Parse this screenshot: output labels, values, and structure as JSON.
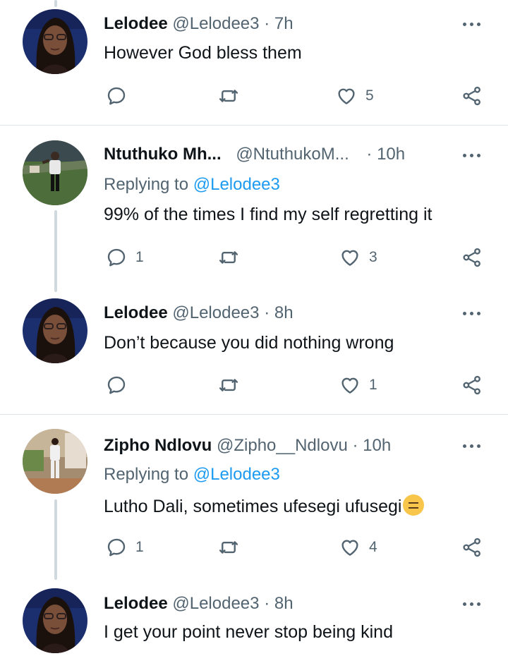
{
  "tweets": [
    {
      "name": "Lelodee",
      "handle": "@Lelodee3",
      "sep": "·",
      "time": "7h",
      "replying_label": "",
      "replying_to": "",
      "text": "However God bless them",
      "replies": "",
      "retweets": "",
      "likes": "5",
      "avatar": "woman-selfie"
    },
    {
      "name": "Ntuthuko Mh...",
      "handle": "@NtuthukoM...",
      "sep": "·",
      "time": "10h",
      "replying_label": "Replying to",
      "replying_to": "@Lelodee3",
      "text": "99% of the times I find my self regretting it",
      "replies": "1",
      "retweets": "",
      "likes": "3",
      "avatar": "man-on-grass"
    },
    {
      "name": "Lelodee",
      "handle": "@Lelodee3",
      "sep": "·",
      "time": "8h",
      "replying_label": "",
      "replying_to": "",
      "text": "Don’t because you did nothing wrong",
      "replies": "",
      "retweets": "",
      "likes": "1",
      "avatar": "woman-selfie"
    },
    {
      "name": "Zipho Ndlovu",
      "handle": "@Zipho__Ndlovu",
      "sep": "·",
      "time": "10h",
      "replying_label": "Replying to",
      "replying_to": "@Lelodee3",
      "text": "Lutho Dali, sometimes ufesegi ufusegi",
      "emoji": "expressionless-face",
      "replies": "1",
      "retweets": "",
      "likes": "4",
      "avatar": "man-standing"
    },
    {
      "name": "Lelodee",
      "handle": "@Lelodee3",
      "sep": "·",
      "time": "8h",
      "replying_label": "",
      "replying_to": "",
      "text": "I get your point never stop being kind",
      "avatar": "woman-selfie"
    }
  ],
  "colors": {
    "text": "#0f1419",
    "muted": "#536471",
    "link": "#1d9bf0",
    "divider": "#dfe5e9",
    "thread": "#cfd9de"
  },
  "icons": [
    "reply-icon",
    "retweet-icon",
    "like-icon",
    "share-icon",
    "more-icon"
  ]
}
